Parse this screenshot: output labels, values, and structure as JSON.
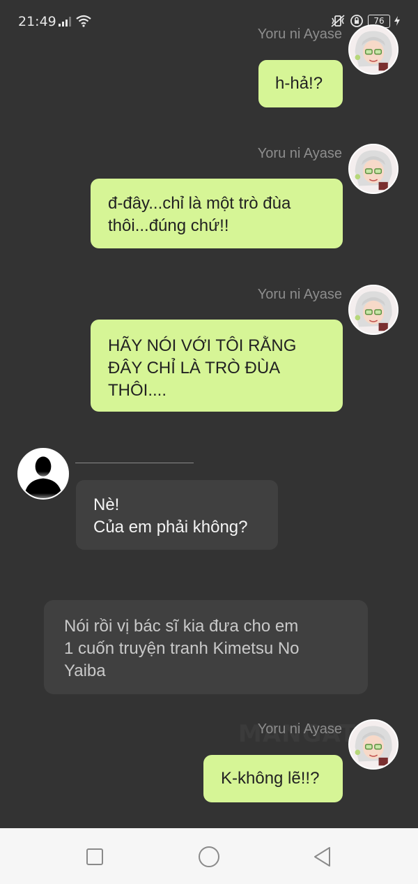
{
  "status_bar": {
    "time": "21:49",
    "battery": "76",
    "icons": [
      "signal-icon",
      "wifi-icon",
      "vibrate-icon",
      "rotation-lock-icon",
      "battery-icon",
      "charging-icon"
    ]
  },
  "messages": [
    {
      "type": "sent",
      "sender": "Yoru ni Ayase",
      "text": "h-hả!?"
    },
    {
      "type": "sent",
      "sender": "Yoru ni Ayase",
      "text": "đ-đây...chỉ là một trò đùa\nthôi...đúng chứ!!"
    },
    {
      "type": "sent",
      "sender": "Yoru ni Ayase",
      "text": "HÃY NÓI VỚI TÔI RẰNG\nĐÂY CHỈ LÀ TRÒ ĐÙA\nTHÔI...."
    },
    {
      "type": "received",
      "sender": "",
      "text": "Nè!\nCủa em phải không?"
    },
    {
      "type": "narration",
      "text": "Nói rồi vị bác sĩ kia đưa cho em\n1 cuốn truyện tranh Kimetsu No\nYaiba"
    },
    {
      "type": "sent",
      "sender": "Yoru ni Ayase",
      "text": "K-không lẽ!!?"
    }
  ],
  "watermark": "MANGATT",
  "nav": {
    "icons": [
      "recent-apps-icon",
      "home-icon",
      "back-icon"
    ]
  },
  "colors": {
    "background": "#333333",
    "sent_bubble": "#d6f596",
    "received_bubble": "#404040",
    "nav_bar": "#f6f6f6"
  }
}
